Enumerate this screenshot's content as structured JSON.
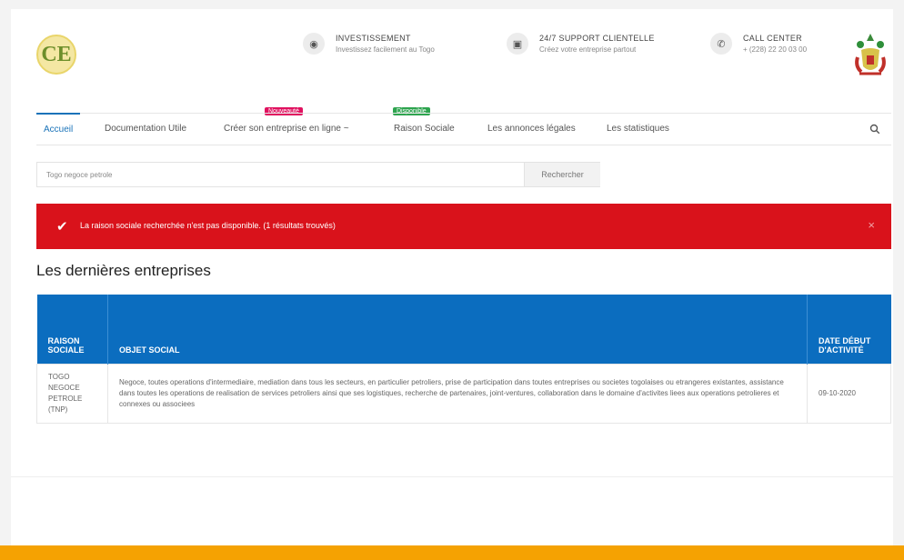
{
  "header": {
    "logo_text": "CE",
    "info": [
      {
        "icon": "eye-icon",
        "title": "INVESTISSEMENT",
        "subtitle": "Investissez facilement au Togo"
      },
      {
        "icon": "support-icon",
        "title": "24/7 SUPPORT CLIENTELLE",
        "subtitle": "Créez votre entreprise partout"
      },
      {
        "icon": "phone-icon",
        "title": "CALL CENTER",
        "subtitle": "+ (228) 22 20 03 00"
      }
    ]
  },
  "nav": {
    "items": [
      "Accueil",
      "Documentation Utile",
      "Créer son entreprise en ligne ~",
      "Raison Sociale",
      "Les annonces légales",
      "Les statistiques"
    ],
    "tags": [
      "Nouveauté",
      "Disponible"
    ]
  },
  "search": {
    "value": "Togo negoce petrole",
    "button": "Rechercher"
  },
  "alert": {
    "message": "La raison sociale recherchée n'est pas disponible. (1 résultats trouvés)",
    "close": "×"
  },
  "section_title": "Les dernières entreprises",
  "table": {
    "headers": [
      "RAISON SOCIALE",
      "OBJET SOCIAL",
      "DATE DÉBUT D'ACTIVITÉ"
    ],
    "rows": [
      {
        "raison": "TOGO NEGOCE PETROLE (TNP)",
        "objet": "Negoce, toutes operations d'intermediaire, mediation dans tous les secteurs, en particulier petroliers, prise de participation dans toutes entreprises ou societes togolaises ou etrangeres existantes, assistance dans toutes les operations de realisation de services petroliers ainsi que ses logistiques, recherche de partenaires, joint-ventures, collaboration dans le domaine d'activites liees aux operations petrolieres et connexes ou associees",
        "date": "09-10-2020"
      }
    ]
  },
  "colors": {
    "primary": "#0b6dbf",
    "alert": "#d9121b",
    "footer": "#f5a202",
    "tag_new": "#e0115f",
    "tag_ok": "#2ea44f"
  }
}
